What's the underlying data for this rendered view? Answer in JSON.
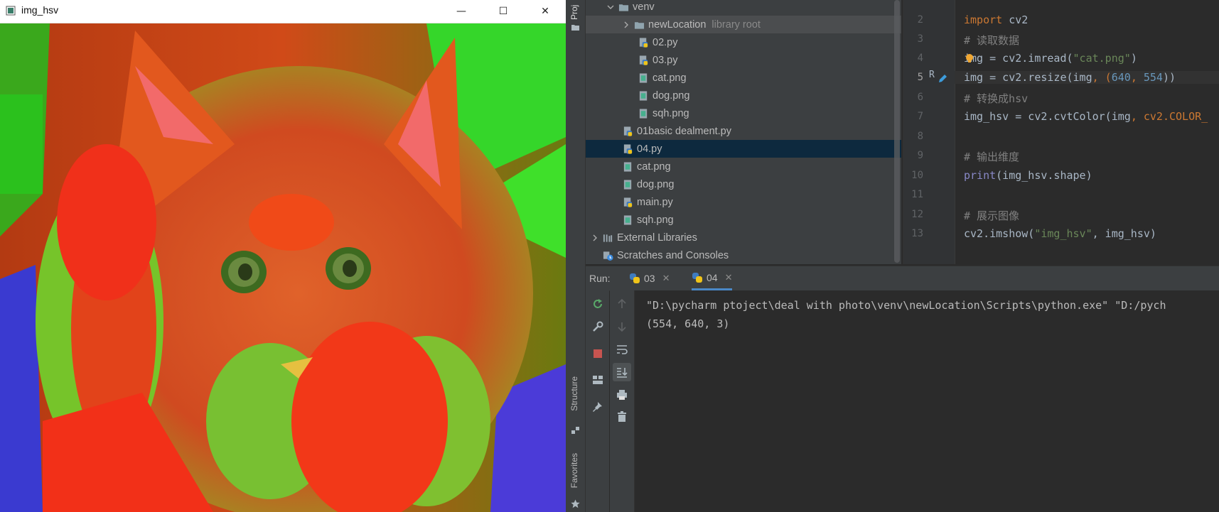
{
  "cv_window": {
    "title": "img_hsv",
    "minimize": "—",
    "maximize": "☐",
    "close": "✕"
  },
  "sidebar": {
    "project_label": "Proj",
    "structure_label": "Structure",
    "favorites_label": "Favorites"
  },
  "tree": {
    "items": [
      {
        "label": "venv",
        "hint": ""
      },
      {
        "label": "newLocation",
        "hint": "library root"
      },
      {
        "label": "02.py",
        "hint": ""
      },
      {
        "label": "03.py",
        "hint": ""
      },
      {
        "label": "cat.png",
        "hint": ""
      },
      {
        "label": "dog.png",
        "hint": ""
      },
      {
        "label": "sqh.png",
        "hint": ""
      },
      {
        "label": "01basic dealment.py",
        "hint": ""
      },
      {
        "label": "04.py",
        "hint": ""
      },
      {
        "label": "cat.png",
        "hint": ""
      },
      {
        "label": "dog.png",
        "hint": ""
      },
      {
        "label": "main.py",
        "hint": ""
      },
      {
        "label": "sqh.png",
        "hint": ""
      },
      {
        "label": "External Libraries",
        "hint": ""
      },
      {
        "label": "Scratches and Consoles",
        "hint": ""
      }
    ]
  },
  "editor": {
    "line_numbers": [
      "2",
      "3",
      "4",
      "5",
      "6",
      "7",
      "8",
      "9",
      "10",
      "11",
      "12",
      "13"
    ],
    "marker": "R",
    "lines": {
      "l2_kw": "import",
      "l2_rest": " cv2",
      "l3": "# 读取数据",
      "l4_a": "img = cv2.imread(",
      "l4_str": "\"cat.png\"",
      "l4_b": ")",
      "l5_a": "img = cv2.resize(img",
      "l5_b": ", (",
      "l5_n1": "640",
      "l5_c": ", ",
      "l5_n2": "554",
      "l5_d": "))",
      "l6": "# 转换成hsv",
      "l7_a": "img_hsv = cv2.cvtColor(img",
      "l7_b": ", cv2.COLOR_",
      "l9": "# 输出维度",
      "l10_fn": "print",
      "l10_rest": "(img_hsv.shape)",
      "l12": "# 展示图像",
      "l13_a": "cv2.imshow(",
      "l13_str": "\"img_hsv\"",
      "l13_b": ", img_hsv)"
    }
  },
  "run": {
    "label": "Run:",
    "tabs": [
      {
        "label": "03",
        "close": "✕"
      },
      {
        "label": "04",
        "close": "✕"
      }
    ],
    "console": [
      "\"D:\\pycharm ptoject\\deal with photo\\venv\\newLocation\\Scripts\\python.exe\" \"D:/pych",
      "(554, 640, 3)"
    ]
  }
}
